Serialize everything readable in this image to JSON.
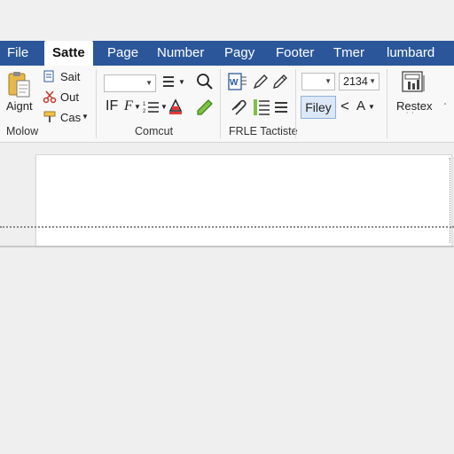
{
  "tabs": [
    "File",
    "Satte",
    "Page",
    "Number",
    "Pagy",
    "Footer",
    "Tmer",
    "lumbard"
  ],
  "clipboard": {
    "big_label": "Aignt",
    "items": [
      "Sait",
      "Out",
      "Cas"
    ],
    "group_label": "Molow"
  },
  "font": {
    "group_label": "Comcut",
    "format_buttons": [
      "IF",
      "F"
    ]
  },
  "paragraph": {
    "group_label": "FRLE Tactiste"
  },
  "styles": {
    "size_value": "2134",
    "highlight_label": "Filey",
    "nav_left": "<",
    "nav_a": "A"
  },
  "editing": {
    "label": "Restex",
    "sub": "˙ ˙"
  },
  "colors": {
    "ribbon_tab_bg": "#2b579a",
    "ribbon_bg": "#f8f8f8",
    "highlight_bg": "#dce8f7"
  }
}
